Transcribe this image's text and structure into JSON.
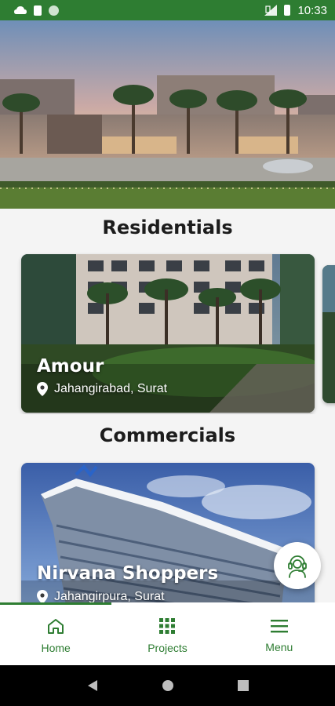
{
  "status_bar": {
    "time": "10:33",
    "icons": [
      "cloud-icon",
      "sim-icon",
      "circle-icon",
      "signal-icon",
      "battery-icon"
    ]
  },
  "hero": {
    "icon": "villa-banner-image"
  },
  "sections": {
    "residentials": "Residentials",
    "commercials": "Commercials"
  },
  "residential_cards": [
    {
      "title": "Amour",
      "location": "Jahangirabad, Surat"
    }
  ],
  "commercial_cards": [
    {
      "title": "Nirvana Shoppers",
      "location": "Jahangirpura, Surat"
    }
  ],
  "fab": {
    "icon": "support-agent-icon"
  },
  "bottom_nav": {
    "items": [
      {
        "label": "Home",
        "icon": "home-icon",
        "active": true
      },
      {
        "label": "Projects",
        "icon": "grid-icon",
        "active": false
      },
      {
        "label": "Menu",
        "icon": "menu-icon",
        "active": false
      }
    ]
  },
  "colors": {
    "brand_green": "#2e7d32",
    "background": "#f4f4f4"
  }
}
